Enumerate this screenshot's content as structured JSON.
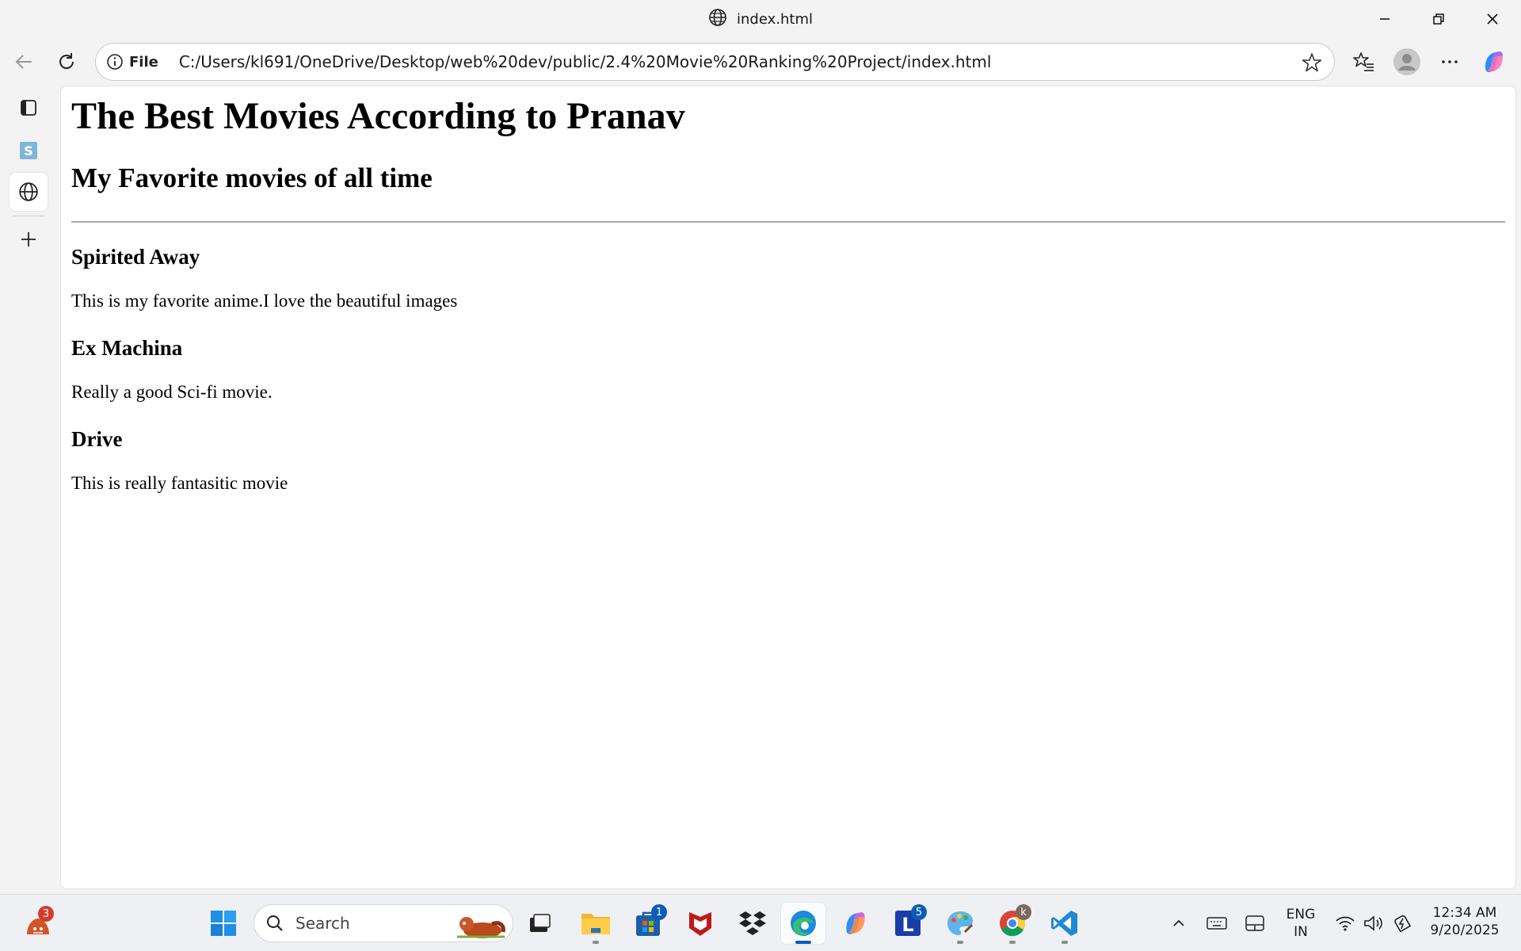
{
  "window": {
    "title": "index.html"
  },
  "address_bar": {
    "scheme_label": "File",
    "url": "C:/Users/kl691/OneDrive/Desktop/web%20dev/public/2.4%20Movie%20Ranking%20Project/index.html"
  },
  "page": {
    "h1": "The Best Movies According to Pranav",
    "h2": "My Favorite movies of all time",
    "movies": [
      {
        "title": "Spirited Away",
        "description": "This is my favorite anime.I love the beautiful images"
      },
      {
        "title": "Ex Machina",
        "description": "Really a good Sci-fi movie."
      },
      {
        "title": "Drive",
        "description": "This is really fantasitic movie"
      }
    ]
  },
  "taskbar": {
    "weather_badge": "3",
    "search_label": "Search",
    "store_badge": "1",
    "launcher_badge": "5",
    "chrome_profile_initial": "k",
    "language": "ENG",
    "region": "IN",
    "time": "12:34 AM",
    "date": "9/20/2025"
  },
  "colors": {
    "accent": "#005fb8",
    "sidebar_s_tile": "#7fb6d9",
    "mcafee_red": "#c01818",
    "vscode_blue": "#1f8ad2"
  }
}
